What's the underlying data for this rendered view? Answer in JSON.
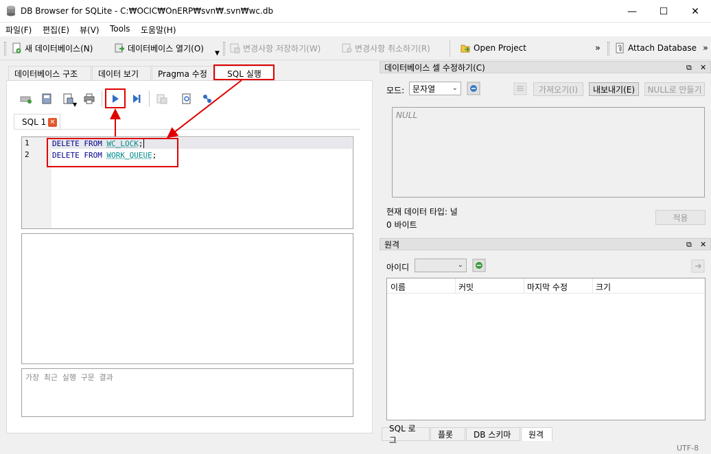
{
  "window": {
    "title": "DB Browser for SQLite - C:₩OCIC₩OnERP₩svn₩.svn₩wc.db",
    "minimize": "—",
    "maximize": "☐",
    "close": "✕"
  },
  "menu": [
    "파일(F)",
    "편집(E)",
    "뷰(V)",
    "Tools",
    "도움말(H)"
  ],
  "toolbar": {
    "new_db": "새 데이터베이스(N)",
    "open_db": "데이터베이스 열기(O)",
    "write_changes": "변경사항 저장하기(W)",
    "revert_changes": "변경사항 취소하기(R)",
    "open_project": "Open Project",
    "more": "»",
    "attach_db": "Attach Database",
    "more2": "»"
  },
  "left_tabs": [
    "데이터베이스 구조",
    "데이터 보기",
    "Pragma 수정",
    "SQL 실행"
  ],
  "sql_tab": {
    "label": "SQL 1"
  },
  "editor": {
    "lines": [
      {
        "no": "1",
        "kw": "DELETE FROM ",
        "table": "WC_LOCK",
        "end": ";"
      },
      {
        "no": "2",
        "kw": "DELETE FROM ",
        "table": "WORK_QUEUE",
        "end": ";"
      }
    ]
  },
  "results_placeholder": "가장 최근 실행 구문 결과",
  "edit_cell": {
    "title": "데이터베이스 셀 수정하기(C)",
    "mode_label": "모드:",
    "mode_value": "문자열",
    "import_btn": "가져오기(I)",
    "export_btn": "내보내기(E)",
    "null_btn": "NULL로 만들기",
    "null_text": "NULL",
    "type_text": "현재 데이터 타입: 널",
    "size_text": "0 바이트",
    "apply_btn": "적용"
  },
  "remote": {
    "title": "원격",
    "id_label": "아이디",
    "columns": [
      "이름",
      "커밋",
      "마지막 수정",
      "크기"
    ]
  },
  "bottom_tabs": [
    "SQL 로그",
    "플롯",
    "DB 스키마",
    "원격"
  ],
  "status": {
    "encoding": "UTF-8"
  },
  "colors": {
    "annotation": "#e00000",
    "keyword": "#00008b",
    "table": "#008b8b"
  }
}
